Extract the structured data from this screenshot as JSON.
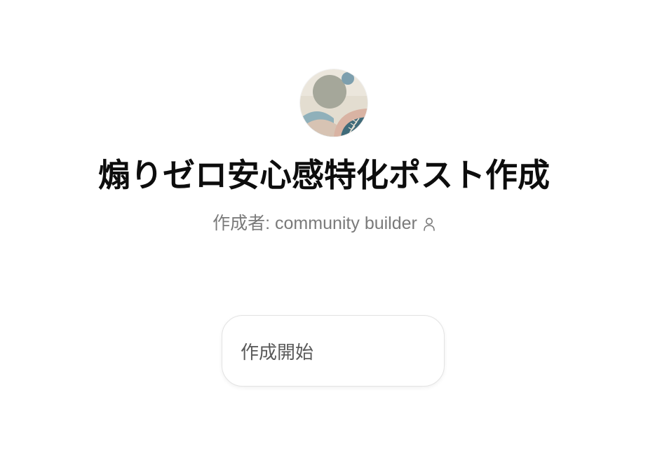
{
  "gpt": {
    "avatar_icon": "abstract-art-avatar-icon",
    "title": "煽りゼロ安心感特化ポスト作成",
    "author_label": "作成者: community builder",
    "author_icon": "person-icon"
  },
  "actions": {
    "conversation_starter": "作成開始"
  },
  "colors": {
    "title": "#0d0d0d",
    "author_text": "#7a7a7a",
    "starter_text": "#5a5a5a",
    "starter_border": "#e3e3e3",
    "background": "#ffffff"
  }
}
